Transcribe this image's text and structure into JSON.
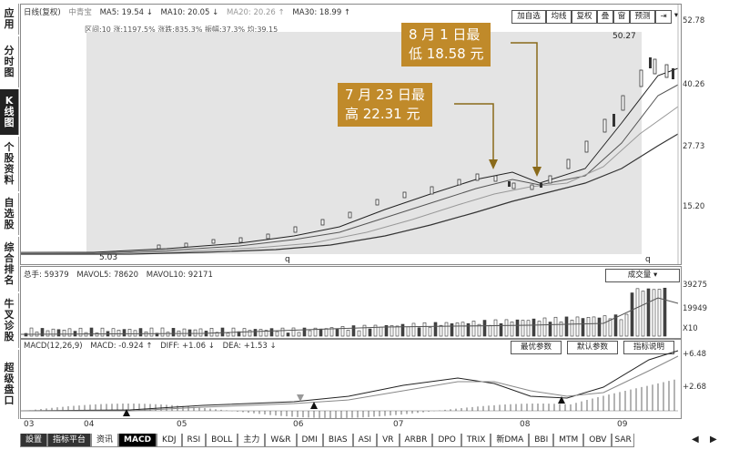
{
  "sidebar": [
    {
      "label": "应用",
      "active": false
    },
    {
      "label": "分时图",
      "active": false
    },
    {
      "label": "K线图",
      "active": true
    },
    {
      "label": "个股资料",
      "active": false
    },
    {
      "label": "自选股",
      "active": false
    },
    {
      "label": "综合排名",
      "active": false
    },
    {
      "label": "牛叉诊股",
      "active": false
    },
    {
      "label": "超级盘口",
      "active": false
    }
  ],
  "kline": {
    "title": "日线(复权)",
    "stock": "中青宝",
    "ma5": "MA5: 19.54 ↓",
    "ma10": "MA10: 20.05 ↓",
    "ma20": "MA20: 20.26 ↑",
    "ma30": "MA30: 18.99 ↑",
    "info": "区间:10  涨:1197.5%  涨跌:835.3%  振幅:37.3%  均:39.15",
    "buttons": [
      "加自选",
      "均线",
      "复权",
      "叠",
      "窗",
      "预测"
    ],
    "y_labels": [
      "52.78",
      "40.26",
      "27.73",
      "15.20"
    ],
    "high": "50.27",
    "low": "5.03",
    "marker": "q",
    "marker2": "q",
    "callout_high": "7 月 23 日最\n高 22.31 元",
    "callout_low": "8 月 1 日最\n低 18.58 元"
  },
  "volume": {
    "total": "总手: 59379",
    "mavol5": "MAVOL5: 78620",
    "mavol10": "MAVOL10: 92171",
    "selector": "成交量",
    "y_labels": [
      "39275",
      "19949"
    ],
    "unit": "X10"
  },
  "macd": {
    "params": "MACD(12,26,9)",
    "macd": "MACD: -0.924 ↑",
    "diff": "DIFF: +1.06 ↓",
    "dea": "DEA: +1.53 ↓",
    "buttons": [
      "最优参数",
      "默认参数",
      "指标说明"
    ],
    "y_labels": [
      "+6.48",
      "+2.68"
    ]
  },
  "x_labels": [
    "03",
    "04",
    "05",
    "06",
    "07",
    "08",
    "09"
  ],
  "bottom_tabs": [
    "設置",
    "指标平台",
    "资讯",
    "MACD",
    "KDJ",
    "RSI",
    "BOLL",
    "主力",
    "W&R",
    "DMI",
    "BIAS",
    "ASI",
    "VR",
    "ARBR",
    "DPO",
    "TRIX",
    "新DMA",
    "BBI",
    "MTM",
    "OBV",
    "SAR"
  ]
}
